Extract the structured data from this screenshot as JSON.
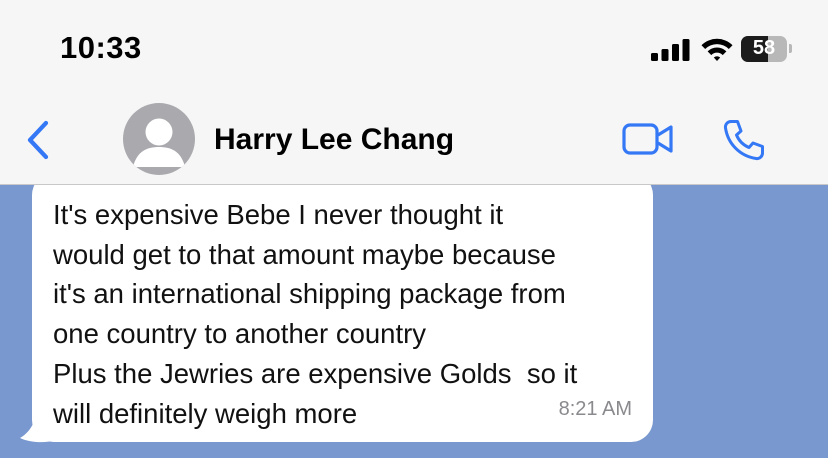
{
  "status_bar": {
    "time": "10:33",
    "battery_level": "58",
    "battery_fraction": 0.58,
    "signal_icon": "cellular-signal-icon",
    "wifi_icon": "wifi-icon",
    "battery_icon": "battery-icon"
  },
  "header": {
    "contact_name": "Harry Lee Chang",
    "back_icon": "chevron-left-icon",
    "avatar_icon": "person-placeholder-icon",
    "video_icon": "video-camera-icon",
    "phone_icon": "phone-icon"
  },
  "colors": {
    "accent": "#3478f6",
    "chat_background": "#7898cf",
    "bubble": "#ffffff",
    "avatar": "#a9a9ae"
  },
  "messages": [
    {
      "direction": "incoming",
      "text": "It's expensive Bebe I never thought it\nwould get to that amount maybe because\nit's an international shipping package from\none country to another country\nPlus the Jewries are expensive Golds  so it\nwill definitely weigh more",
      "time": "8:21 AM"
    }
  ]
}
